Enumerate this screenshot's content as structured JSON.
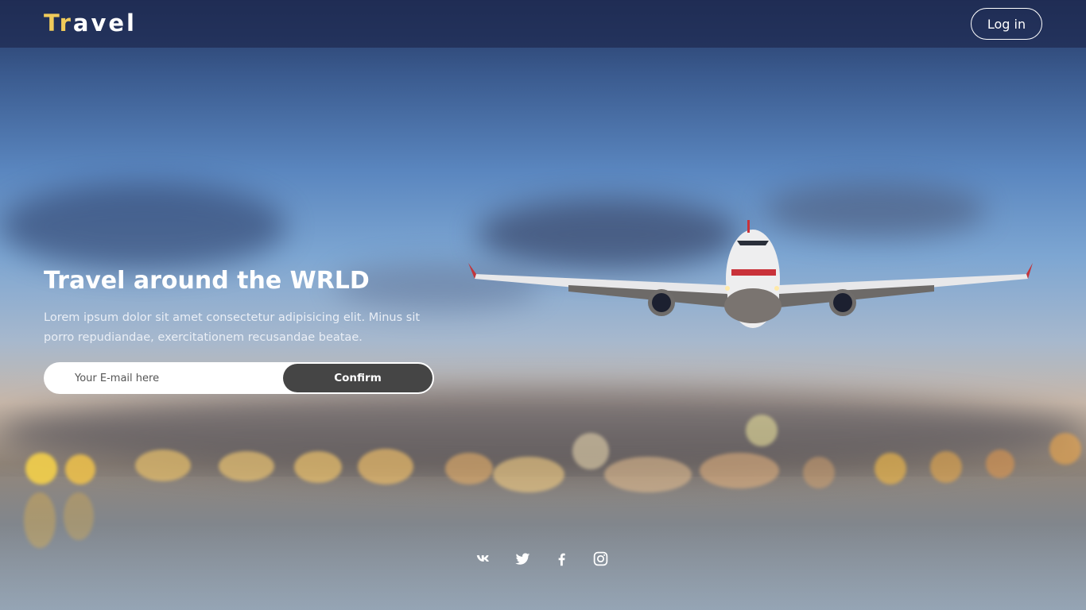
{
  "header": {
    "logo_accent": "Tr",
    "logo_rest": "avel",
    "login_label": "Log in"
  },
  "hero": {
    "title": "Travel around the WRLD",
    "description": "Lorem ipsum dolor sit amet consectetur adipisicing elit. Minus sit porro repudiandae, exercitationem recusandae beatae.",
    "email_placeholder": "Your E-mail here",
    "confirm_label": "Confirm"
  },
  "social": [
    {
      "icon": "vk-icon"
    },
    {
      "icon": "twitter-icon"
    },
    {
      "icon": "facebook-icon"
    },
    {
      "icon": "instagram-icon"
    }
  ],
  "colors": {
    "logo_accent": "#f0cb5a",
    "confirm_bg": "#454545",
    "header_bg": "rgba(30,42,80,0.72)"
  }
}
